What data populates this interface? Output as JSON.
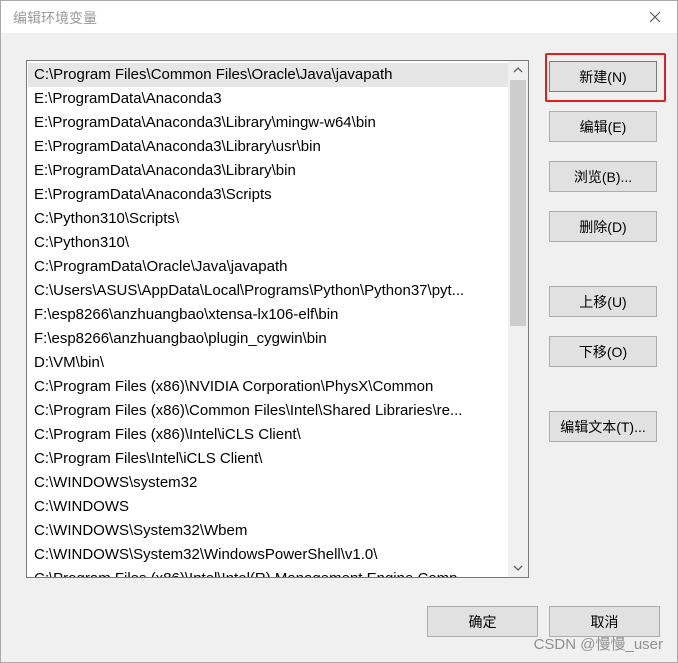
{
  "window": {
    "title": "编辑环境变量",
    "close_icon": "close-icon"
  },
  "path_list": {
    "items": [
      "C:\\Program Files\\Common Files\\Oracle\\Java\\javapath",
      "E:\\ProgramData\\Anaconda3",
      "E:\\ProgramData\\Anaconda3\\Library\\mingw-w64\\bin",
      "E:\\ProgramData\\Anaconda3\\Library\\usr\\bin",
      "E:\\ProgramData\\Anaconda3\\Library\\bin",
      "E:\\ProgramData\\Anaconda3\\Scripts",
      "C:\\Python310\\Scripts\\",
      "C:\\Python310\\",
      "C:\\ProgramData\\Oracle\\Java\\javapath",
      "C:\\Users\\ASUS\\AppData\\Local\\Programs\\Python\\Python37\\pyt...",
      "F:\\esp8266\\anzhuangbao\\xtensa-lx106-elf\\bin",
      "F:\\esp8266\\anzhuangbao\\plugin_cygwin\\bin",
      "D:\\VM\\bin\\",
      "C:\\Program Files (x86)\\NVIDIA Corporation\\PhysX\\Common",
      "C:\\Program Files (x86)\\Common Files\\Intel\\Shared Libraries\\re...",
      "C:\\Program Files (x86)\\Intel\\iCLS Client\\",
      "C:\\Program Files\\Intel\\iCLS Client\\",
      "C:\\WINDOWS\\system32",
      "C:\\WINDOWS",
      "C:\\WINDOWS\\System32\\Wbem",
      "C:\\WINDOWS\\System32\\WindowsPowerShell\\v1.0\\",
      "C:\\Program Files (x86)\\Intel\\Intel(R) Management Engine Comp..."
    ],
    "selected_index": 0
  },
  "buttons": {
    "new": "新建(N)",
    "edit": "编辑(E)",
    "browse": "浏览(B)...",
    "delete": "删除(D)",
    "move_up": "上移(U)",
    "move_down": "下移(O)",
    "edit_text": "编辑文本(T)...",
    "ok": "确定",
    "cancel": "取消"
  },
  "highlight_color": "#e02020",
  "watermark": "CSDN @慢慢_user"
}
